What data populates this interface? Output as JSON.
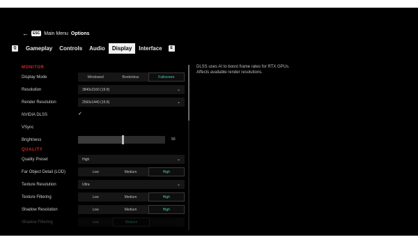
{
  "header": {
    "back_key": "ESC",
    "breadcrumb_parent": "Main Menu",
    "breadcrumb_current": "Options"
  },
  "tabs": {
    "left_key": "Q",
    "right_key": "E",
    "items": [
      {
        "label": "Gameplay",
        "active": false
      },
      {
        "label": "Controls",
        "active": false
      },
      {
        "label": "Audio",
        "active": false
      },
      {
        "label": "Display",
        "active": true
      },
      {
        "label": "Interface",
        "active": false
      }
    ]
  },
  "sections": {
    "monitor": "MONITOR",
    "quality": "QUALITY"
  },
  "settings": {
    "display_mode": {
      "label": "Display Mode",
      "options": [
        "Windowed",
        "Borderless",
        "Fullscreen"
      ],
      "selected": "Fullscreen"
    },
    "resolution": {
      "label": "Resolution",
      "value": "3840x2160 (16:9)"
    },
    "render_resolution": {
      "label": "Render Resolution",
      "value": "2560x1440 (16:9)"
    },
    "nvidia_dlss": {
      "label": "NVIDIA DLSS",
      "checked": true,
      "check_glyph": "✓"
    },
    "vsync": {
      "label": "VSync",
      "checked": false
    },
    "brightness": {
      "label": "Brightness",
      "value": "50",
      "fraction": 0.5
    },
    "quality_preset": {
      "label": "Quality Preset",
      "value": "High"
    },
    "far_object_detail": {
      "label": "Far Object Detail (LOD)",
      "options": [
        "Low",
        "Medium",
        "High"
      ],
      "selected": "High"
    },
    "texture_resolution": {
      "label": "Texture Resolution",
      "value": "Ultra"
    },
    "texture_filtering": {
      "label": "Texture Filtering",
      "options": [
        "Low",
        "Medium",
        "High"
      ],
      "selected": "High"
    },
    "shadow_resolution": {
      "label": "Shadow Resolution",
      "options": [
        "Low",
        "Medium",
        "High"
      ],
      "selected": "High"
    },
    "shadow_filtering": {
      "label": "Shadow Filtering",
      "options": [
        "Low",
        "Medium"
      ],
      "selected": "Medium"
    }
  },
  "description": {
    "text": "DLSS uses AI to boost frame rates for RTX GPUs. Affects available render resolutions."
  },
  "colors": {
    "accent": "#4fd0b4",
    "section_heading": "#d22b2b",
    "background": "#000000"
  },
  "icons": {
    "back": "arrow-left-icon",
    "dropdown": "chevron-down-icon",
    "check": "check-icon"
  }
}
